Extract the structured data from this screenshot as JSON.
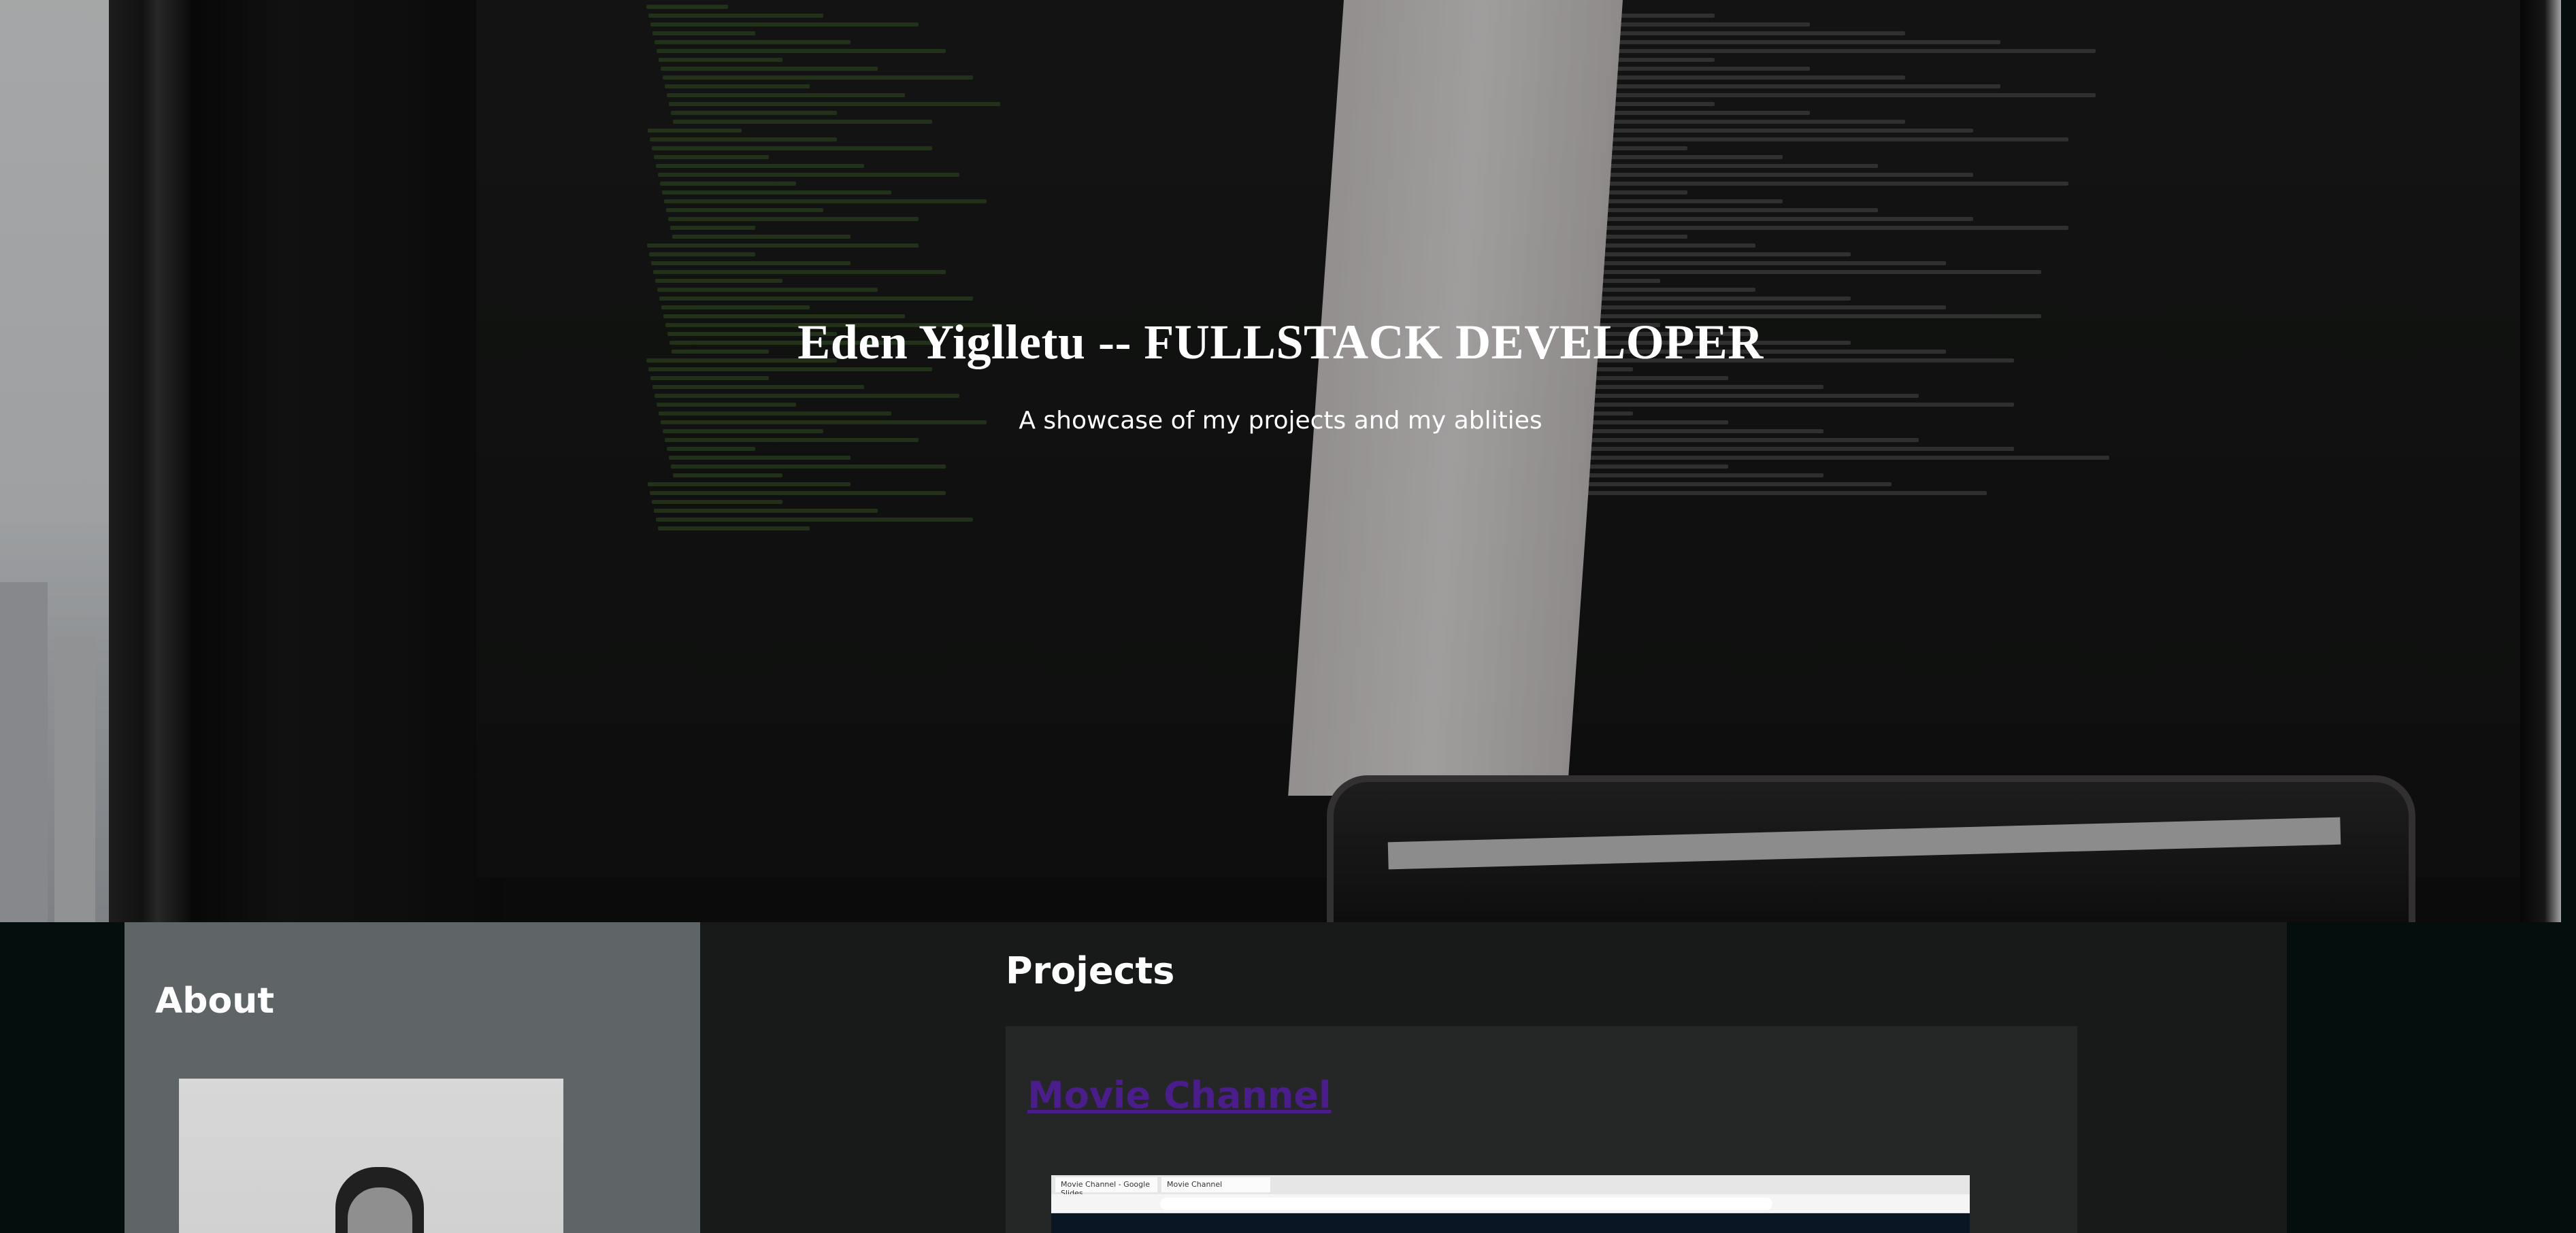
{
  "hero": {
    "title": "Eden Yiglletu -- FULLSTACK DEVELOPER",
    "subtitle": "A showcase of my projects and my ablities"
  },
  "about": {
    "heading": "About"
  },
  "projects": {
    "heading": "Projects",
    "items": [
      {
        "title": "Movie Channel",
        "screenshot": {
          "tab_1": "Movie Channel - Google Slides",
          "tab_2": "Movie Channel"
        }
      }
    ]
  },
  "colors": {
    "page_bg": "#040e0c",
    "about_bg": "#5f6566",
    "projects_bg": "#181a19",
    "card_bg": "#252726",
    "link": "#4b1d8c"
  }
}
